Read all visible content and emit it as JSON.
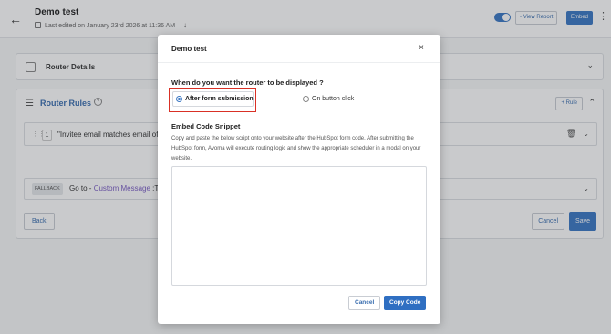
{
  "header": {
    "title": "Demo test",
    "last_edited": "Last edited on January 23rd 2026 at 11:36 AM",
    "view_report": "View Report",
    "embed": "Embed",
    "accent": "#3b78c4"
  },
  "router_details": {
    "label": "Router Details"
  },
  "router_rules": {
    "label": "Router Rules",
    "help": "?",
    "add_rule": "+ Rule",
    "rule": {
      "number": "1",
      "text": "\"Invitee email matches email of H"
    },
    "fallback": {
      "badge": "FALLBACK",
      "prefix": "Go to - ",
      "link": "Custom Message",
      "suffix": " :Tha"
    },
    "back": "Back",
    "cancel": "Cancel",
    "save": "Save"
  },
  "modal": {
    "title": "Demo test",
    "close": "×",
    "question": "When do you want the router to be displayed ?",
    "options": [
      {
        "label": "After form submission",
        "selected": true
      },
      {
        "label": "On button click",
        "selected": false
      }
    ],
    "snippet_title": "Embed Code Snippet",
    "snippet_description": "Copy and paste the below script onto your website after the HubSpot form code. After submitting the HubSpot form, Avoma will execute routing logic and show the appropriate scheduler in a modal on your website.",
    "code_value": "",
    "cancel": "Cancel",
    "copy": "Copy Code",
    "highlight_color": "#d93025"
  },
  "icons": {
    "back": "arrow-left-icon",
    "calendar": "calendar-icon",
    "download": "download-icon",
    "chart": "bar-chart-icon",
    "more": "more-vertical-icon",
    "close": "close-icon",
    "trash": "trash-icon",
    "chevron": "chevron-down-icon"
  }
}
